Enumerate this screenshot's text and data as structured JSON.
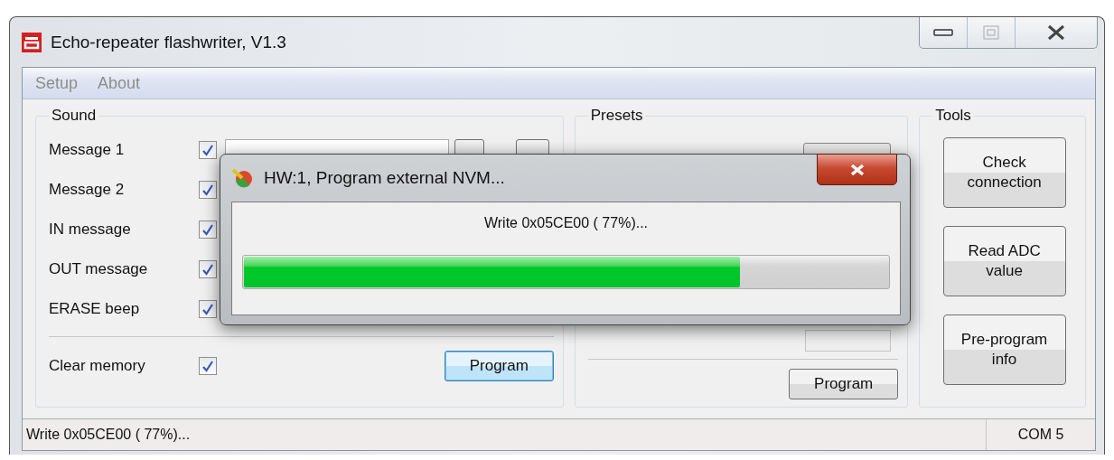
{
  "window": {
    "title": "Echo-repeater flashwriter, V1.3"
  },
  "menu": [
    {
      "label": "Setup",
      "disabled": true
    },
    {
      "label": "About",
      "disabled": true
    }
  ],
  "sound": {
    "title": "Sound",
    "rows": [
      {
        "label": "Message 1",
        "checked": true
      },
      {
        "label": "Message 2",
        "checked": true
      },
      {
        "label": "IN message",
        "checked": true
      },
      {
        "label": "OUT message",
        "checked": true
      },
      {
        "label": "ERASE beep",
        "checked": true
      }
    ],
    "clear_memory": {
      "label": "Clear memory",
      "checked": true
    },
    "program_button": {
      "label": "Program",
      "focused": true
    }
  },
  "presets": {
    "title": "Presets",
    "program_button": {
      "label": "Program",
      "focused": false
    }
  },
  "tools": {
    "title": "Tools",
    "buttons": [
      "Check connection",
      "Read ADC value",
      "Pre-program info"
    ]
  },
  "dialog": {
    "title": "HW:1, Program external NVM...",
    "message": "Write 0x05CE00 ( 77%)...",
    "level": 0.77
  },
  "status_bar": {
    "message": "Write 0x05CE00 ( 77%)...",
    "port": "COM 5"
  }
}
